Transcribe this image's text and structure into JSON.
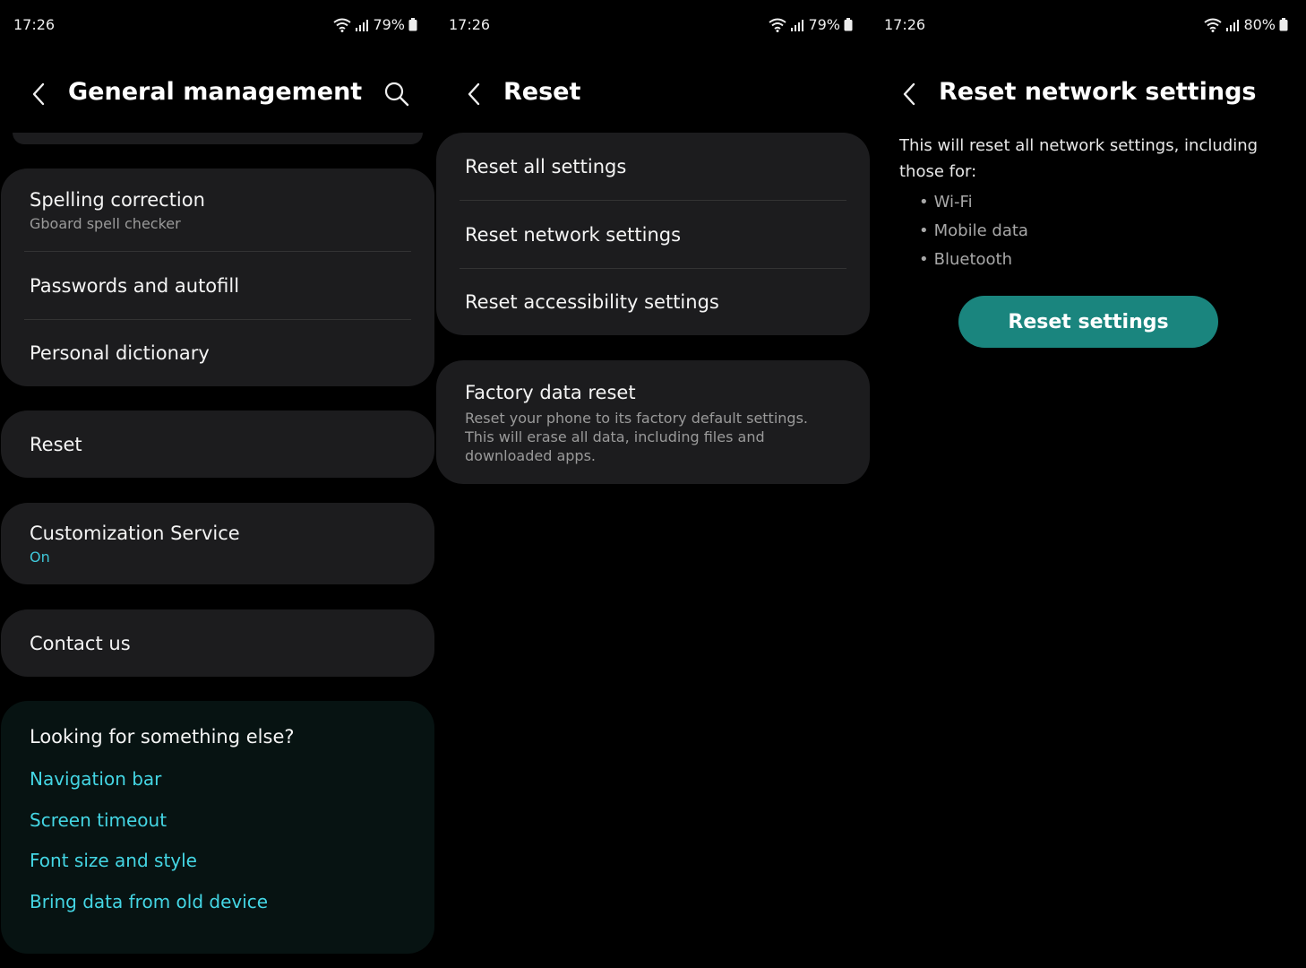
{
  "colors": {
    "background": "#000000",
    "card": "#1c1c1e",
    "accent_text": "#44d6e4",
    "button": "#1a857e",
    "suggestion_bg": "#071312"
  },
  "screens": [
    {
      "status": {
        "time": "17:26",
        "battery": "79%"
      },
      "title": "General management",
      "icons": [
        "back-arrow-icon",
        "search-icon"
      ],
      "card1": [
        {
          "label": "Spelling correction",
          "sub": "Gboard spell checker"
        },
        {
          "label": "Passwords and autofill"
        },
        {
          "label": "Personal dictionary"
        }
      ],
      "reset": {
        "label": "Reset"
      },
      "customization": {
        "label": "Customization Service",
        "sub": "On"
      },
      "contact": {
        "label": "Contact us"
      },
      "suggestions": {
        "heading": "Looking for something else?",
        "links": [
          "Navigation bar",
          "Screen timeout",
          "Font size and style",
          "Bring data from old device"
        ]
      }
    },
    {
      "status": {
        "time": "17:26",
        "battery": "79%"
      },
      "title": "Reset",
      "card1": [
        "Reset all settings",
        "Reset network settings",
        "Reset accessibility settings"
      ],
      "factory": {
        "label": "Factory data reset",
        "desc": "Reset your phone to its factory default settings. This will erase all data, including files and downloaded apps."
      }
    },
    {
      "status": {
        "time": "17:26",
        "battery": "80%"
      },
      "title": "Reset network settings",
      "info": "This will reset all network settings, including those for:",
      "bullets": [
        "Wi-Fi",
        "Mobile data",
        "Bluetooth"
      ],
      "button": "Reset settings"
    }
  ]
}
